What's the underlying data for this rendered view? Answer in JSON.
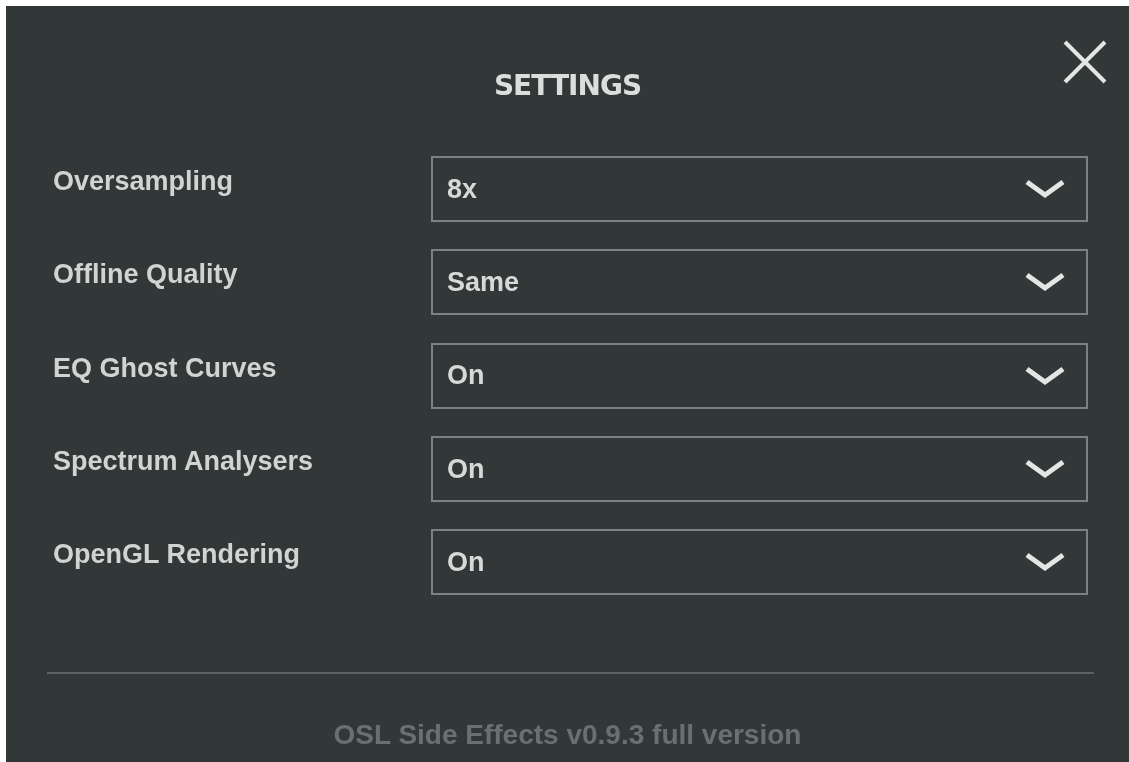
{
  "title": "SETTINGS",
  "settings": [
    {
      "label": "Oversampling",
      "value": "8x"
    },
    {
      "label": "Offline Quality",
      "value": "Same"
    },
    {
      "label": "EQ Ghost Curves",
      "value": "On"
    },
    {
      "label": "Spectrum Analysers",
      "value": "On"
    },
    {
      "label": "OpenGL Rendering",
      "value": "On"
    }
  ],
  "footer": "OSL Side Effects v0.9.3 full version"
}
